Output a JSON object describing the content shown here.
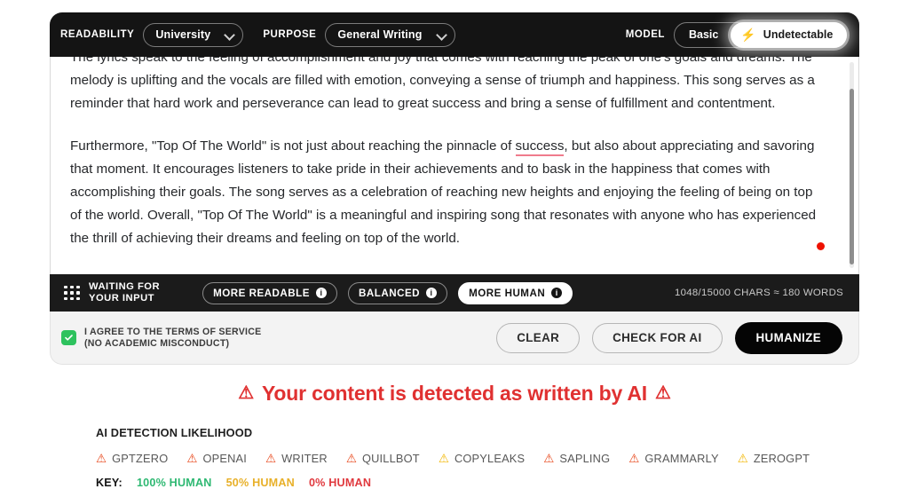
{
  "editor": {
    "toolbar": {
      "readability_label": "READABILITY",
      "readability_value": "University",
      "purpose_label": "PURPOSE",
      "purpose_value": "General Writing",
      "model_label": "MODEL",
      "model_basic": "Basic",
      "model_undetectable": "Undetectable",
      "bolt_glyph": "⚡"
    },
    "content": {
      "paragraph_1_before": "The lyrics speak to the feeling of accomplishment and joy that comes with reaching the peak of one's goals and dreams. The melody is uplifting and the vocals are filled with emotion, conveying a sense of triumph and happiness. This song serves as a reminder that hard work and perseverance can lead to great success and bring a sense of fulfillment and contentment.",
      "paragraph_2_before": "Furthermore, \"Top Of The World\" is not just about reaching the pinnacle of ",
      "paragraph_2_flagged": "success",
      "paragraph_2_after": ", but also about appreciating and savoring that moment. It encourages listeners to take pride in their achievements and to bask in the happiness that comes with accomplishing their goals. The song serves as a celebration of reaching new heights and enjoying the feeling of being on top of the world. Overall, \"Top Of The World\" is a meaningful and inspiring song that resonates with anyone who has experienced the thrill of achieving their dreams and feeling on top of the world."
    },
    "statusbar": {
      "status_line_1": "WAITING FOR",
      "status_line_2": "YOUR INPUT",
      "tone_more_readable": "MORE READABLE",
      "tone_balanced": "BALANCED",
      "tone_more_human": "MORE HUMAN",
      "info_glyph": "i",
      "char_count": "1048/15000 CHARS ≈ 180 WORDS"
    },
    "footer": {
      "agree_line_1": "I AGREE TO THE TERMS OF SERVICE",
      "agree_line_2": "(NO ACADEMIC MISCONDUCT)",
      "clear_label": "CLEAR",
      "check_label": "CHECK FOR AI",
      "humanize_label": "HUMANIZE"
    }
  },
  "results": {
    "verdict_text": "Your content is detected as written by AI",
    "warning_glyph": "⚠",
    "likelihood_title": "AI DETECTION LIKELIHOOD",
    "detectors": [
      {
        "name": "GPTZERO",
        "color": "#e8481c"
      },
      {
        "name": "OPENAI",
        "color": "#e8481c"
      },
      {
        "name": "WRITER",
        "color": "#e8481c"
      },
      {
        "name": "QUILLBOT",
        "color": "#e8481c"
      },
      {
        "name": "COPYLEAKS",
        "color": "#f2b705"
      },
      {
        "name": "SAPLING",
        "color": "#e8481c"
      },
      {
        "name": "GRAMMARLY",
        "color": "#e8481c"
      },
      {
        "name": "ZEROGPT",
        "color": "#f2b705"
      }
    ],
    "key_label": "KEY:",
    "key_items": [
      {
        "label": "100% HUMAN",
        "color": "#2eb872"
      },
      {
        "label": "50% HUMAN",
        "color": "#e8b029"
      },
      {
        "label": "0% HUMAN",
        "color": "#e0393e"
      }
    ]
  },
  "colors": {
    "accent_red": "#e03131",
    "accent_green": "#2ec25e",
    "accent_amber": "#f5a623",
    "flag_underline": "#f07b8c"
  }
}
